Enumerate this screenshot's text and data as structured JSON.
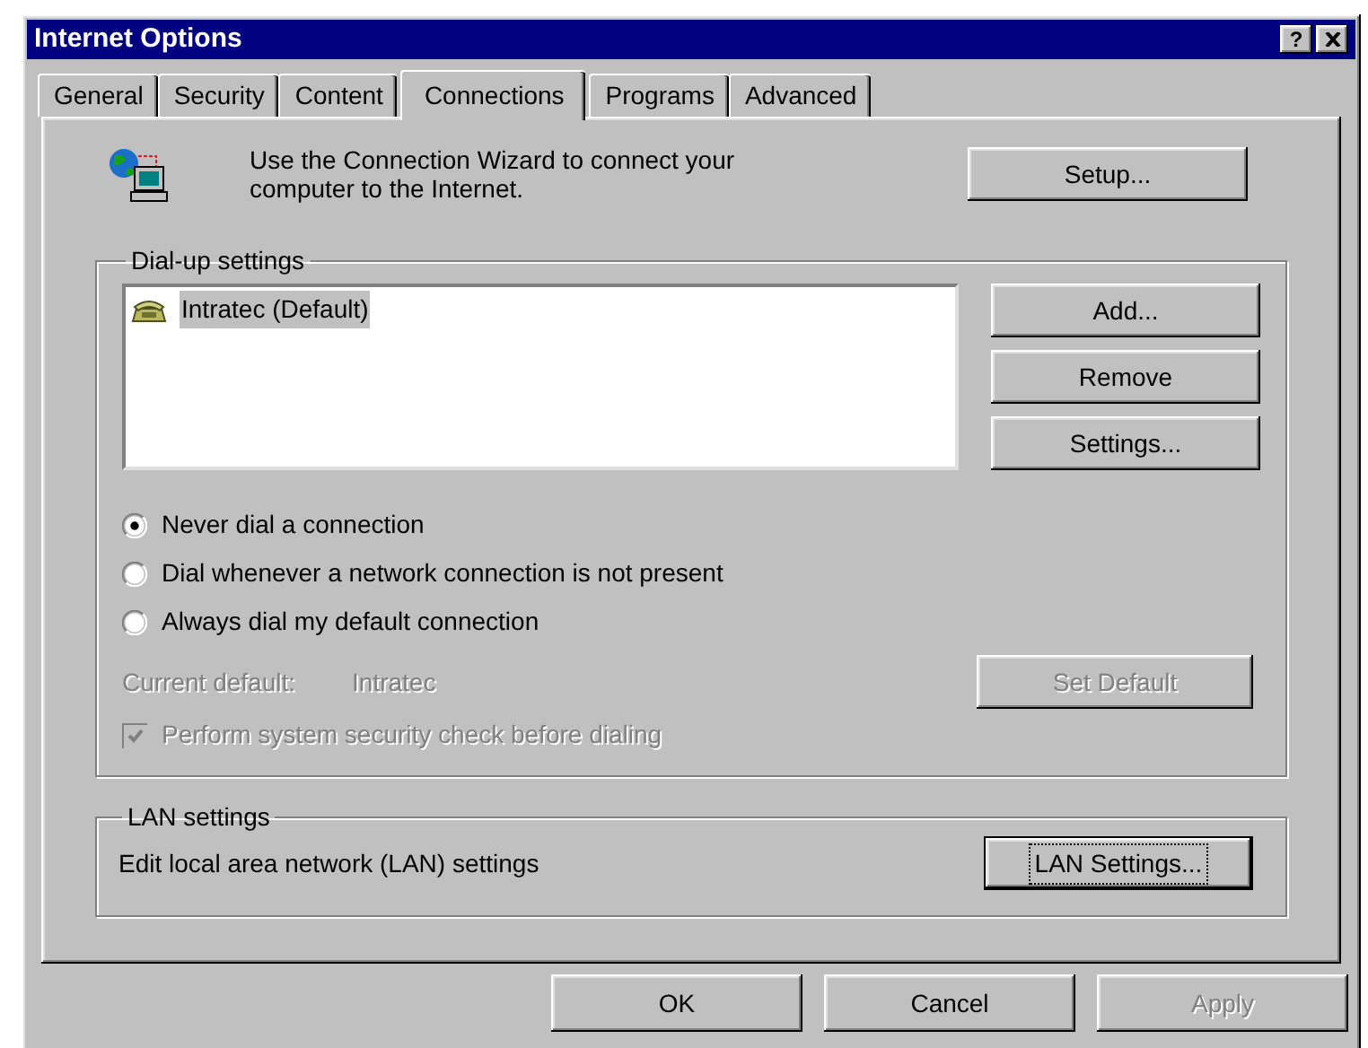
{
  "window": {
    "title": "Internet Options",
    "help_button": "?"
  },
  "tabs": [
    {
      "label": "General",
      "selected": false
    },
    {
      "label": "Security",
      "selected": false
    },
    {
      "label": "Content",
      "selected": false
    },
    {
      "label": "Connections",
      "selected": true
    },
    {
      "label": "Programs",
      "selected": false
    },
    {
      "label": "Advanced",
      "selected": false
    }
  ],
  "intro": {
    "text": "Use the Connection Wizard to connect your computer to the Internet.",
    "button": "Setup..."
  },
  "dialup": {
    "title": "Dial-up settings",
    "connections": [
      {
        "name": "Intratec (Default)",
        "selected": true
      }
    ],
    "buttons": [
      {
        "label": "Add..."
      },
      {
        "label": "Remove"
      },
      {
        "label": "Settings..."
      }
    ],
    "options": [
      {
        "label": "Never dial a connection",
        "selected": true
      },
      {
        "label": "Dial whenever a network connection is not present",
        "selected": false
      },
      {
        "label": "Always dial my default connection",
        "selected": false
      }
    ],
    "current_default": {
      "label": "Current default:",
      "value": "Intratec",
      "disabled": true
    },
    "set_default": {
      "label": "Set Default",
      "disabled": true
    },
    "security_check": {
      "label": "Perform system security check before dialing",
      "checked": true,
      "disabled": true
    }
  },
  "lan": {
    "title": "LAN settings",
    "text": "Edit local area network (LAN) settings",
    "button": "LAN Settings...",
    "focused": true
  },
  "buttons": [
    {
      "label": "OK",
      "disabled": false
    },
    {
      "label": "Cancel",
      "disabled": false
    },
    {
      "label": "Apply",
      "disabled": true
    }
  ]
}
